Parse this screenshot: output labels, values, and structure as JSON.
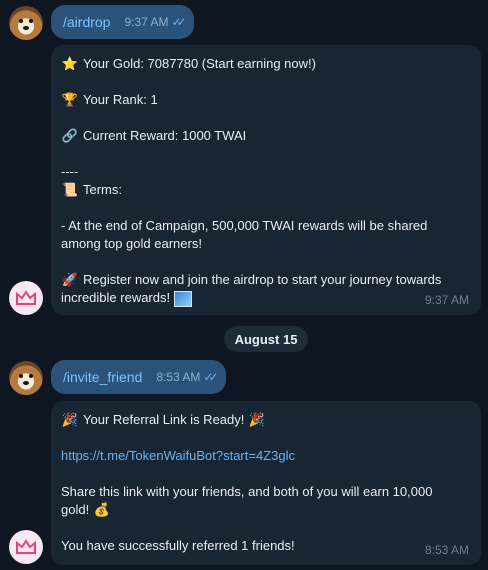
{
  "messages": {
    "airdrop_cmd": {
      "text": "/airdrop",
      "time": "9:37 AM",
      "ticks": "✓✓"
    },
    "airdrop_reply": {
      "gold": "Your Gold: 7087780 (Start earning now!)",
      "rank": "Your Rank: 1",
      "reward": "Current Reward: 1000 TWAI",
      "dashes": "----",
      "terms": "Terms:",
      "terms_body": "-  At the end of Campaign, 500,000 TWAI rewards will be shared among top gold earners!",
      "register": "Register now and join the airdrop to start your journey towards incredible rewards!",
      "time": "9:37 AM"
    },
    "date_separator": "August 15",
    "invite_cmd": {
      "text": "/invite_friend",
      "time": "8:53 AM",
      "ticks": "✓✓"
    },
    "invite_reply": {
      "title": "Your Referral Link is Ready!",
      "link": "https://t.me/TokenWaifuBot?start=4Z3glc",
      "share": "Share this link with your friends, and both of you will earn 10,000 gold!",
      "referred": "You have successfully referred 1 friends!",
      "time": "8:53 AM"
    }
  },
  "icons": {
    "star": "⭐",
    "trophy": "🏆",
    "link": "🔗",
    "scroll": "📜",
    "rocket": "🚀",
    "party": "🎉",
    "moneybag": "💰"
  },
  "colors": {
    "background": "#0e1621",
    "outgoing_bubble": "#2b5278",
    "incoming_bubble": "#182533",
    "link": "#6ab3f3"
  }
}
